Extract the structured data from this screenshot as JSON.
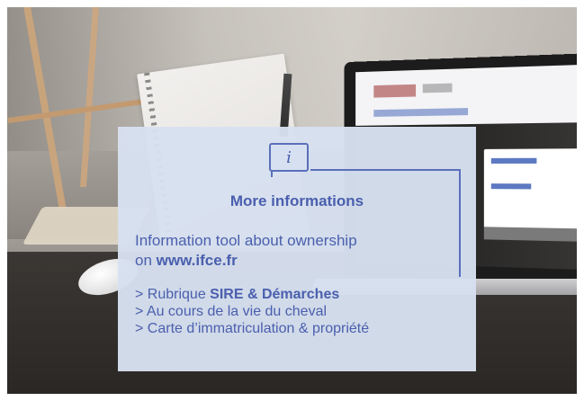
{
  "card": {
    "icon": "info-icon",
    "icon_glyph": "i",
    "title": "More informations",
    "description_text": "Information tool about ownership",
    "description_prefix": "on ",
    "description_link": "www.ifce.fr",
    "items": [
      {
        "prefix": "> Rubrique ",
        "bold": "SIRE & Démarches"
      },
      {
        "prefix": "> Au cours de la vie du cheval",
        "bold": ""
      },
      {
        "prefix": "> Carte d’immatriculation & propriété",
        "bold": ""
      }
    ]
  },
  "colors": {
    "card_background": "#d7e0f0",
    "text_blue": "#4a5fae",
    "accent_line": "#5a6fbb"
  }
}
